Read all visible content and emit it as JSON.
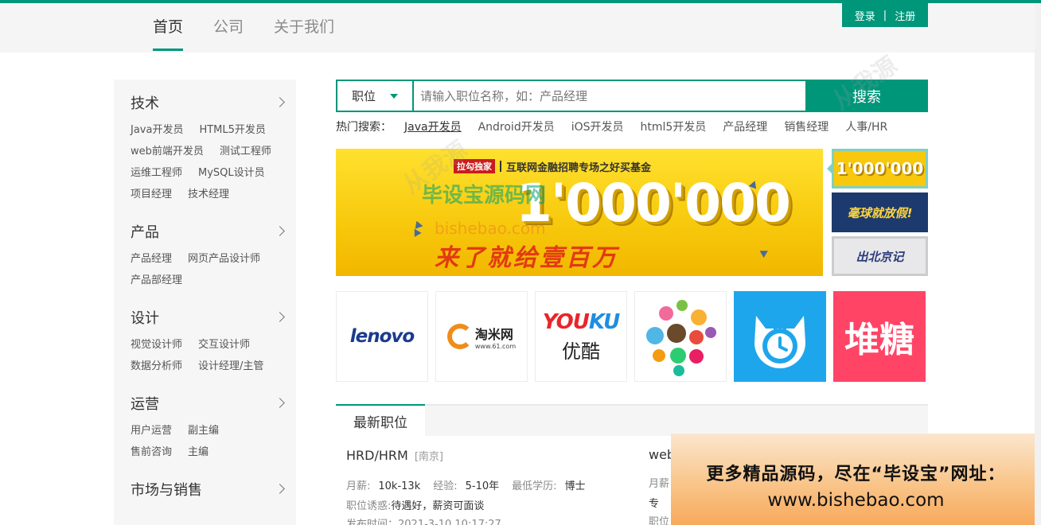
{
  "nav": {
    "items": [
      {
        "label": "首页",
        "active": true
      },
      {
        "label": "公司",
        "active": false
      },
      {
        "label": "关于我们",
        "active": false
      }
    ]
  },
  "auth": {
    "login": "登录",
    "separator": "|",
    "register": "注册"
  },
  "sidebar": {
    "categories": [
      {
        "title": "技术",
        "items": [
          "Java开发员",
          "HTML5开发员",
          "web前端开发员",
          "测试工程师",
          "运维工程师",
          "MySQL设计员",
          "项目经理",
          "技术经理"
        ]
      },
      {
        "title": "产品",
        "items": [
          "产品经理",
          "网页产品设计师",
          "产品部经理"
        ]
      },
      {
        "title": "设计",
        "items": [
          "视觉设计师",
          "交互设计师",
          "数据分析师",
          "设计经理/主管"
        ]
      },
      {
        "title": "运营",
        "items": [
          "用户运营",
          "副主编",
          "售前咨询",
          "主编"
        ]
      },
      {
        "title": "市场与销售",
        "items": []
      }
    ]
  },
  "search": {
    "type_label": "职位",
    "placeholder": "请输入职位名称，如：产品经理",
    "button": "搜索"
  },
  "hot": {
    "label": "热门搜索：",
    "items": [
      "Java开发员",
      "Android开发员",
      "iOS开发员",
      "html5开发员",
      "产品经理",
      "销售经理",
      "人事/HR"
    ]
  },
  "banner": {
    "badge": "拉勾独家",
    "tag": "互联网金融招聘专场之好买基金",
    "number": "1'000'000",
    "subtitle": "来了就给壹百万"
  },
  "thumbs": [
    "1'000'000",
    "毫球就放假!",
    "出北京记"
  ],
  "logos": {
    "lenovo": "lenovo",
    "taomi_cn": "淘米网",
    "taomi_url": "www.61.com",
    "youku_en_red": "YOU",
    "youku_en_blue": "KU",
    "youku_cn": "优酷",
    "duitang": "堆糖"
  },
  "tabs": {
    "active": "最新职位"
  },
  "job": {
    "title": "HRD/HRM",
    "city": "[南京]",
    "salary_label": "月薪:",
    "salary": "10k-13k",
    "exp_label": "经验:",
    "exp": "5-10年",
    "edu_label": "最低学历:",
    "edu": "博士",
    "perk_label": "职位诱惑:",
    "perk": "待遇好，薪资可面谈",
    "time": "发布时间：2021-3-10 10:17:27"
  },
  "job2": {
    "title": "web",
    "l1": "月薪",
    "l2": "专",
    "l3": "职位"
  },
  "watermark": {
    "site": "毕设宝源码网",
    "domain": "bishebao.com",
    "side": "从我源"
  },
  "promo": {
    "line1": "更多精品源码，尽在“毕设宝”网址：",
    "line2": "www.bishebao.com"
  }
}
